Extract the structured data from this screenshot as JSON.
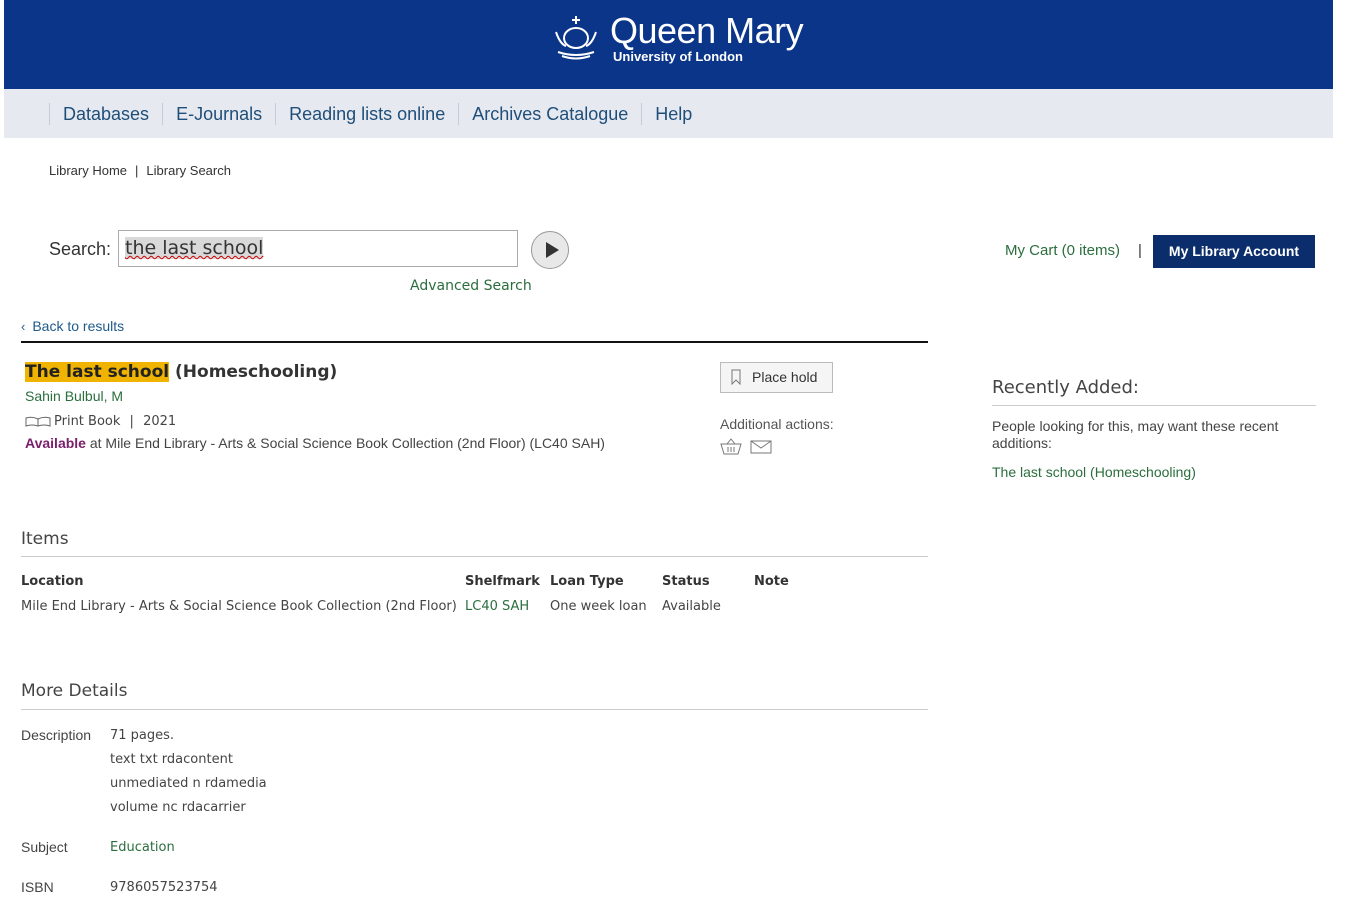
{
  "header": {
    "logo_name": "Queen Mary",
    "logo_sub": "University of London",
    "brand_color": "#0b3589"
  },
  "nav": {
    "items": [
      {
        "label": "Databases"
      },
      {
        "label": "E-Journals"
      },
      {
        "label": "Reading lists online"
      },
      {
        "label": "Archives Catalogue"
      },
      {
        "label": "Help"
      }
    ]
  },
  "breadcrumb": {
    "home": "Library Home",
    "separator": "|",
    "current": "Library Search"
  },
  "search": {
    "label": "Search:",
    "value": "the last school",
    "advanced": "Advanced Search"
  },
  "account": {
    "cart": "My Cart (0 items)",
    "separator": "|",
    "button": "My Library Account"
  },
  "record": {
    "back": "Back to results",
    "title_highlight": "The last school",
    "title_rest": " (Homeschooling)",
    "author": "Sahin Bulbul, M",
    "format": "Print Book",
    "format_sep": "|",
    "year": "2021",
    "available_word": "Available",
    "available_rest": " at Mile End Library - Arts & Social Science Book Collection (2nd Floor) (LC40 SAH)",
    "place_hold": "Place hold",
    "additional_actions": "Additional actions:"
  },
  "items": {
    "heading": "Items",
    "columns": [
      "Location",
      "Shelfmark",
      "Loan Type",
      "Status",
      "Note"
    ],
    "rows": [
      {
        "location": "Mile End Library - Arts & Social Science Book Collection (2nd Floor)",
        "shelfmark": "LC40 SAH",
        "loan_type": "One week loan",
        "status": "Available",
        "note": ""
      }
    ]
  },
  "details": {
    "heading": "More Details",
    "description_label": "Description",
    "description": [
      "71 pages.",
      "text txt rdacontent",
      "unmediated n rdamedia",
      "volume nc rdacarrier"
    ],
    "subject_label": "Subject",
    "subject": "Education",
    "isbn_label": "ISBN",
    "isbn": "9786057523754"
  },
  "recent": {
    "heading": "Recently Added:",
    "text": "People looking for this, may want these recent additions:",
    "link": "The last school (Homeschooling)"
  }
}
